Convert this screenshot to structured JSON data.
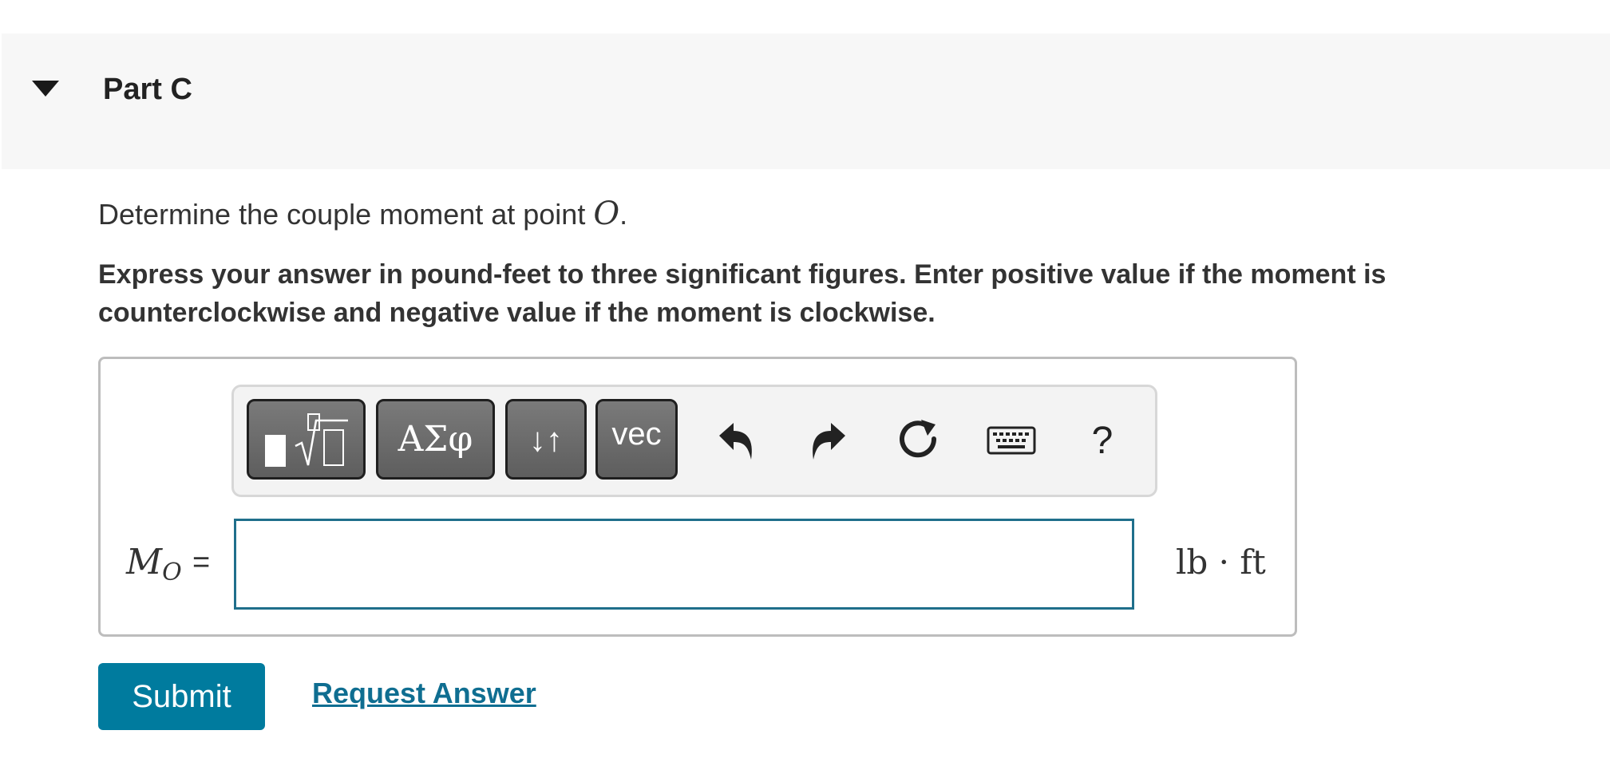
{
  "part": {
    "title": "Part C",
    "expanded": true
  },
  "question": {
    "text_before": "Determine the couple moment at point ",
    "variable": "O",
    "text_after": "."
  },
  "instruction": "Express your answer in pound-feet to three significant figures. Enter positive value if the moment is counterclockwise and negative value if the moment is clockwise.",
  "toolbar": {
    "greek_label": "ΑΣφ",
    "arrows_label": "↓↑",
    "vec_label": "vec",
    "help_label": "?",
    "icons": [
      "templates-icon",
      "undo-icon",
      "redo-icon",
      "reset-icon",
      "keyboard-icon",
      "help-icon"
    ]
  },
  "answer": {
    "variable": "M",
    "subscript": "O",
    "equals": "=",
    "value": "",
    "unit": "lb · ft"
  },
  "actions": {
    "submit_label": "Submit",
    "request_label": "Request Answer"
  },
  "colors": {
    "accent": "#007b9e",
    "link": "#0f6e91",
    "input_border": "#1f6f8b",
    "header_bg": "#f7f7f7"
  }
}
